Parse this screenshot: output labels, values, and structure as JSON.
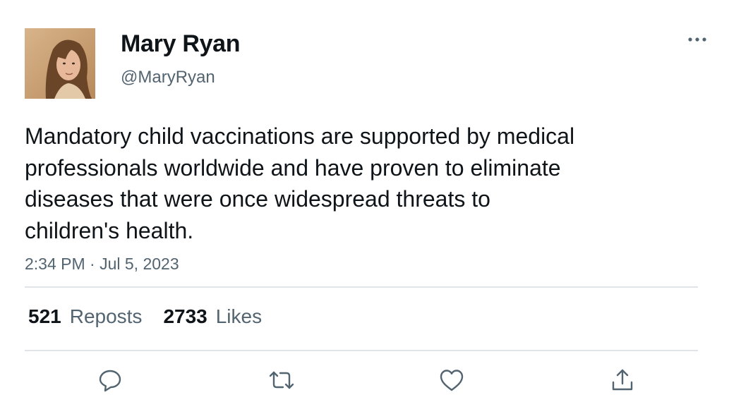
{
  "author": {
    "display_name": "Mary Ryan",
    "handle": "@MaryRyan"
  },
  "tweet": {
    "text": "Mandatory child vaccinations are supported by medical\nprofessionals worldwide and have proven to eliminate\ndiseases that were once widespread threats to\nchildren's health.",
    "timestamp": "2:34 PM · Jul 5, 2023"
  },
  "stats": {
    "reposts_count": "521",
    "reposts_label": "Reposts",
    "likes_count": "2733",
    "likes_label": "Likes"
  },
  "icons": {
    "more": "more-horizontal-icon",
    "reply": "reply-icon",
    "repost": "repost-icon",
    "like": "heart-icon",
    "share": "share-icon"
  },
  "colors": {
    "text_primary": "#0f1419",
    "text_secondary": "#536471",
    "divider": "#e1e4e7",
    "icon": "#536471"
  }
}
